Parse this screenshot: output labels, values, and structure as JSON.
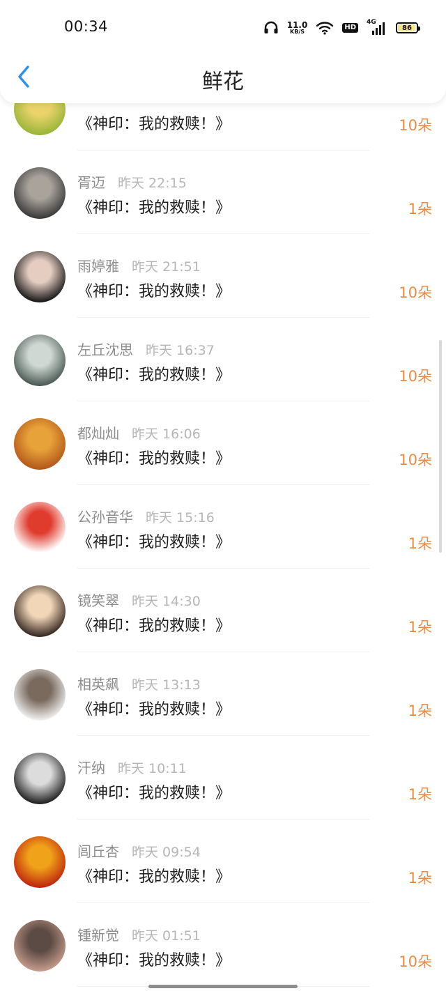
{
  "status_bar": {
    "time": "00:34",
    "network_speed": "11.0",
    "network_unit": "KB/S",
    "hd_badge": "HD",
    "cell_label": "4G",
    "battery_level": "86"
  },
  "header": {
    "title": "鲜花",
    "back_icon": "chevron-left-icon"
  },
  "list": {
    "items": [
      {
        "name": "",
        "date": "",
        "book": "《神印：我的救赎！》",
        "amount": "10朵",
        "avatar_colors": [
          "#9ab53a",
          "#e9d36a"
        ]
      },
      {
        "name": "胥迈",
        "date": "昨天 22:15",
        "book": "《神印：我的救赎！》",
        "amount": "1朵",
        "avatar_colors": [
          "#3b3b3b",
          "#a9a39c"
        ]
      },
      {
        "name": "雨婷雅",
        "date": "昨天 21:51",
        "book": "《神印：我的救赎！》",
        "amount": "10朵",
        "avatar_colors": [
          "#1a1a1a",
          "#e5cdc2"
        ]
      },
      {
        "name": "左丘沈思",
        "date": "昨天 16:37",
        "book": "《神印：我的救赎！》",
        "amount": "10朵",
        "avatar_colors": [
          "#4d5b55",
          "#cfd8d2"
        ]
      },
      {
        "name": "都灿灿",
        "date": "昨天 16:06",
        "book": "《神印：我的救赎！》",
        "amount": "10朵",
        "avatar_colors": [
          "#b4591b",
          "#e8a23a"
        ]
      },
      {
        "name": "公孙音华",
        "date": "昨天 15:16",
        "book": "《神印：我的救赎！》",
        "amount": "1朵",
        "avatar_colors": [
          "#ffffff",
          "#e03c2e"
        ]
      },
      {
        "name": "镜笑翠",
        "date": "昨天 14:30",
        "book": "《神印：我的救赎！》",
        "amount": "1朵",
        "avatar_colors": [
          "#3a2a24",
          "#f1d6b8"
        ]
      },
      {
        "name": "相英飙",
        "date": "昨天 13:13",
        "book": "《神印：我的救赎！》",
        "amount": "1朵",
        "avatar_colors": [
          "#efefef",
          "#7a6a5e"
        ]
      },
      {
        "name": "汗纳",
        "date": "昨天 10:11",
        "book": "《神印：我的救赎！》",
        "amount": "1朵",
        "avatar_colors": [
          "#222222",
          "#dcdcdc"
        ]
      },
      {
        "name": "闾丘杏",
        "date": "昨天 09:54",
        "book": "《神印：我的救赎！》",
        "amount": "1朵",
        "avatar_colors": [
          "#c0280d",
          "#f0a21a"
        ]
      },
      {
        "name": "锺新觉",
        "date": "昨天 01:51",
        "book": "《神印：我的救赎！》",
        "amount": "10朵",
        "avatar_colors": [
          "#c49a8a",
          "#5c4a44"
        ]
      }
    ]
  }
}
